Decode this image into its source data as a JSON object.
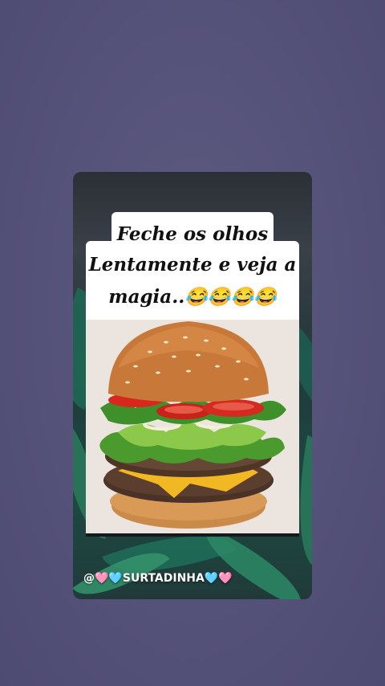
{
  "caption": {
    "line1": "Feche os olhos",
    "line2": "Lentamente e veja a",
    "line3": "magia..😂😂😂😂"
  },
  "watermark": {
    "text": "@🩷🩵SURTADINHA🩵🩷"
  },
  "photo": {
    "subject": "hamburger-image"
  },
  "colors": {
    "background": "#55527a",
    "caption_bg": "#ffffff",
    "caption_text": "#111111"
  }
}
